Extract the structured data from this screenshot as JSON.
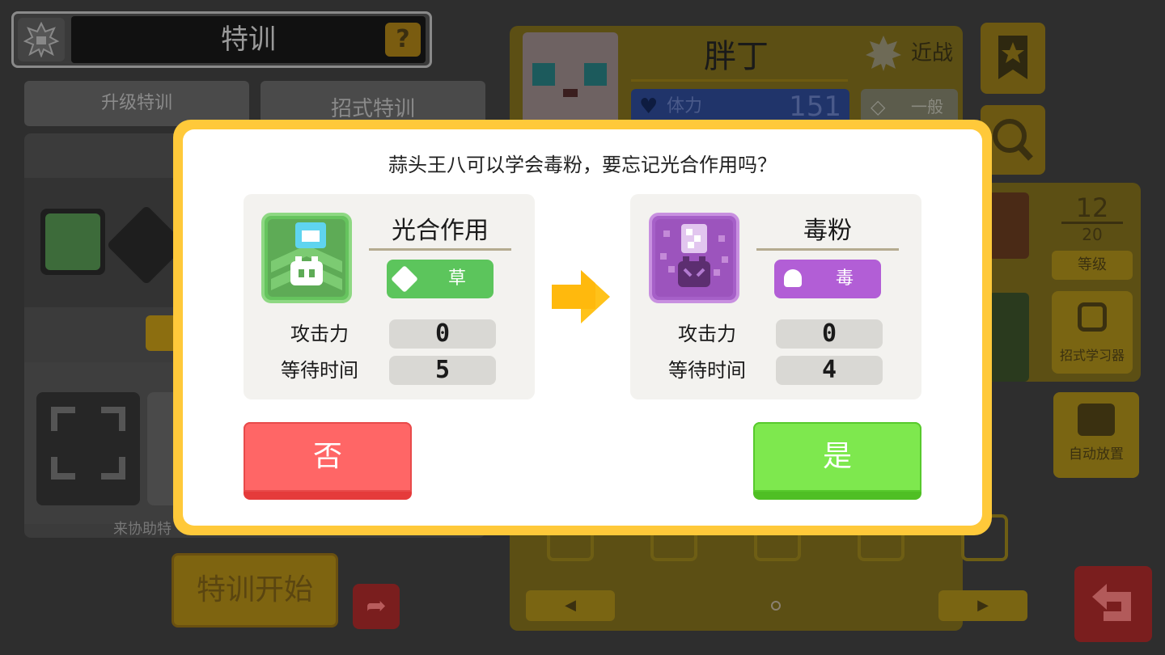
{
  "header": {
    "title": "特训",
    "help_icon": "question-icon",
    "emblem_icon": "spiky-badge-icon"
  },
  "tabs": [
    {
      "label": "升级特训"
    },
    {
      "label": "招式特训"
    }
  ],
  "left_panel": {
    "helper_text": "来协助特",
    "start_button": "特训开始"
  },
  "pokemon": {
    "name": "胖丁",
    "style": "近战",
    "hp_label": "体力",
    "hp_value": "151",
    "category": "一般"
  },
  "level": {
    "current": "12",
    "max": "20",
    "label": "等级"
  },
  "side_buttons": {
    "learn_machine": "招式学习器",
    "auto_place": "自动放置"
  },
  "dialog": {
    "question": "蒜头王八可以学会毒粉，要忘记光合作用吗？",
    "old_move": {
      "name": "光合作用",
      "type": "草",
      "type_color": "#5cc55c",
      "icon_color": "#5ec05a",
      "stats": [
        {
          "label": "攻击力",
          "value": "0"
        },
        {
          "label": "等待时间",
          "value": "5"
        }
      ]
    },
    "new_move": {
      "name": "毒粉",
      "type": "毒",
      "type_color": "#b25ed6",
      "icon_color": "#a660c8",
      "stats": [
        {
          "label": "攻击力",
          "value": "0"
        },
        {
          "label": "等待时间",
          "value": "4"
        }
      ]
    },
    "no_button": "否",
    "yes_button": "是"
  },
  "colors": {
    "modal_border": "#ffc93a",
    "no": "#ff6666",
    "yes": "#7ee84e",
    "arrow": "#ffc21a"
  }
}
